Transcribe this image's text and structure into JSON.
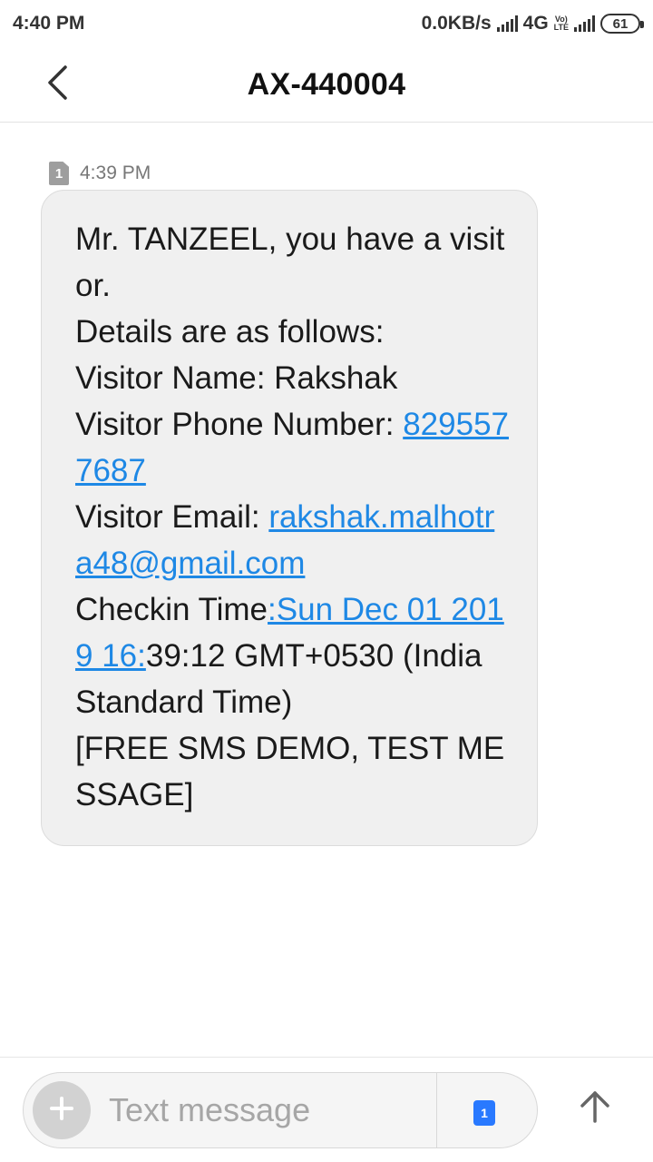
{
  "status_bar": {
    "time": "4:40 PM",
    "network_speed": "0.0KB/s",
    "network_type": "4G",
    "volte_top": "Vo)",
    "volte_bottom": "LTE",
    "battery": "61"
  },
  "header": {
    "title": "AX-440004",
    "back_icon": "chevron-left-icon"
  },
  "message": {
    "sim_slot": "1",
    "timestamp": "4:39 PM",
    "line1": "Mr. TANZEEL, you have a visitor.",
    "line2": "Details are as follows:",
    "line3": "Visitor Name: Rakshak",
    "phone_label": "Visitor Phone Number: ",
    "phone_link": "8295577687",
    "email_label": "Visitor Email: ",
    "email_link": "rakshak.malhotra48@gmail.com",
    "checkin_label": "Checkin Time",
    "checkin_link": ":Sun Dec 01 2019 16:",
    "checkin_rest": "39:12 GMT+0530 (India Standard Time)",
    "footer": "[FREE SMS DEMO, TEST MESSAGE]",
    "link_color": "#1e88e5",
    "bubble_color": "#f0f0f0"
  },
  "composer": {
    "add_icon": "plus-icon",
    "placeholder": "Text message",
    "sim_slot": "1",
    "send_icon": "arrow-up-icon",
    "sim_color": "#2979ff"
  }
}
